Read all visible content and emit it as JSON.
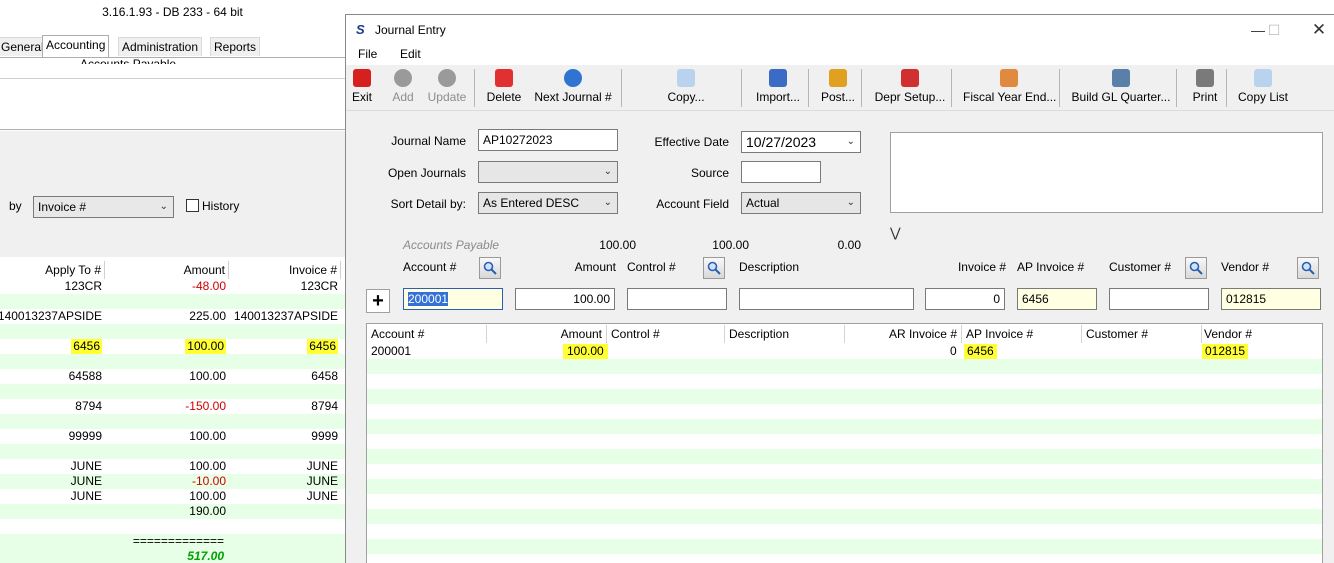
{
  "bg": {
    "title": "3.16.1.93 - DB 233 - 64 bit",
    "tabs": [
      "General",
      "Accounting",
      "Administration",
      "Reports"
    ],
    "panel_text": "Accounts Payable",
    "by_label": "by",
    "sort_value": "Invoice #",
    "history_label": "History",
    "columns": [
      "Apply To #",
      "Amount",
      "Invoice #"
    ],
    "rows": [
      {
        "apply": "123CR",
        "amount": "-48.00",
        "invoice": "123CR",
        "neg": true
      },
      {
        "apply": "140013237APSIDE",
        "amount": "225.00",
        "invoice": "140013237APSIDE"
      },
      {
        "apply": "6456",
        "amount": "100.00",
        "invoice": "6456",
        "hl": true
      },
      {
        "apply": "64588",
        "amount": "100.00",
        "invoice": "6458"
      },
      {
        "apply": "8794",
        "amount": "-150.00",
        "invoice": "8794",
        "neg": true
      },
      {
        "apply": "99999",
        "amount": "100.00",
        "invoice": "9999"
      },
      {
        "apply": "JUNE",
        "amount": "100.00",
        "invoice": "JUNE"
      },
      {
        "apply": "JUNE",
        "amount": "-10.00",
        "invoice": "JUNE",
        "neg": true
      },
      {
        "apply": "JUNE",
        "amount": "100.00",
        "invoice": "JUNE"
      },
      {
        "apply": "",
        "amount": "190.00",
        "invoice": ""
      }
    ],
    "separator": "=============",
    "total": "517.00"
  },
  "je": {
    "title": "Journal Entry",
    "logo": "S",
    "menu": [
      "File",
      "Edit"
    ],
    "toolbar": [
      {
        "label": "Exit",
        "icon": "exit-icon",
        "color": "#d62020"
      },
      {
        "label": "Add",
        "icon": "add-icon",
        "color": "#9a9a9a",
        "disabled": true
      },
      {
        "label": "Update",
        "icon": "update-icon",
        "color": "#9a9a9a",
        "disabled": true
      },
      {
        "label": "Delete",
        "icon": "delete-icon",
        "color": "#e03030"
      },
      {
        "label": "Next Journal #",
        "icon": "next-journal-icon",
        "color": "#2f74d0"
      },
      {
        "label": "Copy...",
        "icon": "copy-icon",
        "color": "#b9d3ee"
      },
      {
        "label": "Import...",
        "icon": "import-icon",
        "color": "#3b6bc4"
      },
      {
        "label": "Post...",
        "icon": "post-icon",
        "color": "#e0a020"
      },
      {
        "label": "Depr Setup...",
        "icon": "depr-setup-icon",
        "color": "#d03030"
      },
      {
        "label": "Fiscal Year End...",
        "icon": "fiscal-year-end-icon",
        "color": "#e08a40"
      },
      {
        "label": "Build GL Quarter...",
        "icon": "build-gl-quarter-icon",
        "color": "#5a7fa8"
      },
      {
        "label": "Print",
        "icon": "print-icon",
        "color": "#7a7a7a"
      },
      {
        "label": "Copy List",
        "icon": "copy-list-icon",
        "color": "#b9d3ee"
      }
    ],
    "form": {
      "journal_name_label": "Journal Name",
      "journal_name": "AP10272023",
      "open_journals_label": "Open Journals",
      "open_journals": "",
      "sort_detail_label": "Sort Detail by:",
      "sort_detail": "As Entered DESC",
      "effective_date_label": "Effective Date",
      "effective_date": "10/27/2023",
      "source_label": "Source",
      "source": "",
      "account_field_label": "Account Field",
      "account_field": "Actual"
    },
    "summary": {
      "label": "Accounts Payable",
      "v1": "100.00",
      "v2": "100.00",
      "v3": "0.00"
    },
    "entry_labels": {
      "account": "Account #",
      "amount": "Amount",
      "control": "Control #",
      "description": "Description",
      "invoice": "Invoice #",
      "ap_invoice": "AP Invoice #",
      "customer": "Customer #",
      "vendor": "Vendor #"
    },
    "entry": {
      "account": "200001",
      "amount": "100.00",
      "control": "",
      "description": "",
      "invoice": "0",
      "ap_invoice": "6456",
      "customer": "",
      "vendor": "012815"
    },
    "grid_columns": [
      "Account #",
      "Amount",
      "Control #",
      "Description",
      "AR Invoice #",
      "AP Invoice #",
      "Customer #",
      "Vendor #"
    ],
    "grid_row": {
      "account": "200001",
      "amount": "100.00",
      "control": "",
      "description": "",
      "ar_invoice": "0",
      "ap_invoice": "6456",
      "customer": "",
      "vendor": "012815"
    }
  },
  "colors": {
    "highlight": "#ffff33",
    "alt_row": "#e6ffe6",
    "negative": "#d00000",
    "total": "#00a000"
  }
}
